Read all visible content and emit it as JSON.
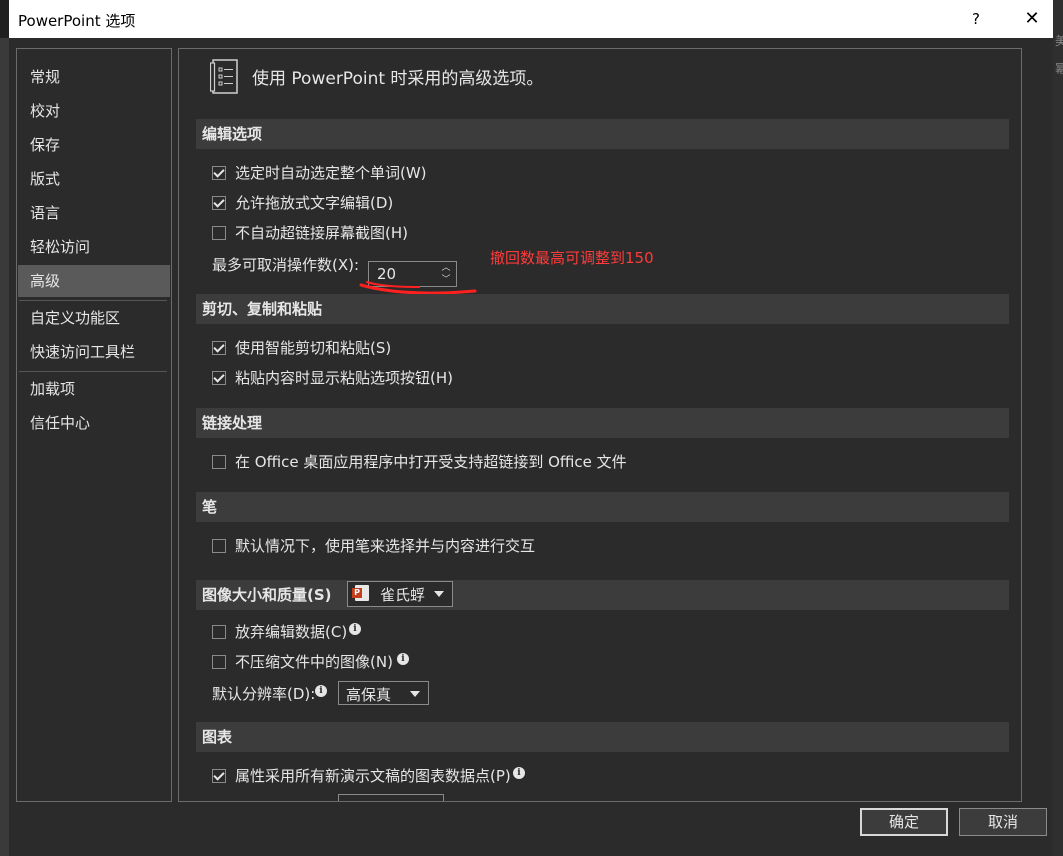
{
  "window": {
    "title": "PowerPoint 选项",
    "help_label": "?",
    "close_label": "✕"
  },
  "background_fragments": [
    "美",
    "幂"
  ],
  "sidebar": {
    "items": [
      {
        "label": "常规"
      },
      {
        "label": "校对"
      },
      {
        "label": "保存"
      },
      {
        "label": "版式"
      },
      {
        "label": "语言"
      },
      {
        "label": "轻松访问"
      },
      {
        "label": "高级",
        "active": true
      },
      {
        "label": "自定义功能区"
      },
      {
        "label": "快速访问工具栏"
      },
      {
        "label": "加载项"
      },
      {
        "label": "信任中心"
      }
    ]
  },
  "main": {
    "header": "使用 PowerPoint 时采用的高级选项。",
    "sections": {
      "edit": {
        "title": "编辑选项",
        "options": [
          {
            "label": "选定时自动选定整个单词(W)",
            "checked": true
          },
          {
            "label": "允许拖放式文字编辑(D)",
            "checked": true
          },
          {
            "label": "不自动超链接屏幕截图(H)",
            "checked": false
          }
        ],
        "undo_label": "最多可取消操作数(X):",
        "undo_value": "20",
        "annotation": "撤回数最高可调整到150"
      },
      "clipboard": {
        "title": "剪切、复制和粘贴",
        "options": [
          {
            "label": "使用智能剪切和粘贴(S)",
            "checked": true
          },
          {
            "label": "粘贴内容时显示粘贴选项按钮(H)",
            "checked": true
          }
        ]
      },
      "links": {
        "title": "链接处理",
        "options": [
          {
            "label": "在 Office 桌面应用程序中打开受支持超链接到 Office 文件",
            "checked": false
          }
        ]
      },
      "pen": {
        "title": "笔",
        "options": [
          {
            "label": "默认情况下，使用笔来选择并与内容进行交互",
            "checked": false
          }
        ]
      },
      "image": {
        "title": "图像大小和质量(S)",
        "file_select": "雀氏蜉",
        "options": [
          {
            "label": "放弃编辑数据(C)",
            "checked": false
          },
          {
            "label": "不压缩文件中的图像(N)",
            "checked": false
          }
        ],
        "resolution_label": "默认分辨率(D):",
        "resolution_value": "高保真"
      },
      "chart": {
        "title": "图表",
        "options": [
          {
            "label": "属性采用所有新演示文稿的图表数据点(P)",
            "checked": true
          }
        ]
      }
    }
  },
  "buttons": {
    "ok": "确定",
    "cancel": "取消"
  },
  "colors": {
    "background": "#2b2b2b",
    "section_header": "#3c3c3c",
    "active_nav": "#5a5a5a",
    "annotation": "#ff3b3b"
  }
}
